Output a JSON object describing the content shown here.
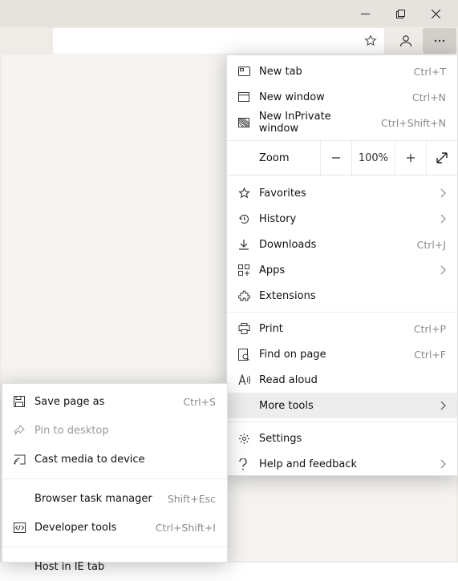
{
  "menu": {
    "new_tab": {
      "label": "New tab",
      "shortcut": "Ctrl+T"
    },
    "new_window": {
      "label": "New window",
      "shortcut": "Ctrl+N"
    },
    "new_inprivate": {
      "label": "New InPrivate window",
      "shortcut": "Ctrl+Shift+N"
    },
    "zoom": {
      "label": "Zoom",
      "percent": "100%"
    },
    "favorites": {
      "label": "Favorites"
    },
    "history": {
      "label": "History"
    },
    "downloads": {
      "label": "Downloads",
      "shortcut": "Ctrl+J"
    },
    "apps": {
      "label": "Apps"
    },
    "extensions": {
      "label": "Extensions"
    },
    "print": {
      "label": "Print",
      "shortcut": "Ctrl+P"
    },
    "find": {
      "label": "Find on page",
      "shortcut": "Ctrl+F"
    },
    "read_aloud": {
      "label": "Read aloud"
    },
    "more_tools": {
      "label": "More tools"
    },
    "settings": {
      "label": "Settings"
    },
    "help": {
      "label": "Help and feedback"
    }
  },
  "submenu": {
    "save_as": {
      "label": "Save page as",
      "shortcut": "Ctrl+S"
    },
    "pin": {
      "label": "Pin to desktop"
    },
    "cast": {
      "label": "Cast media to device"
    },
    "task_mgr": {
      "label": "Browser task manager",
      "shortcut": "Shift+Esc"
    },
    "dev_tools": {
      "label": "Developer tools",
      "shortcut": "Ctrl+Shift+I"
    },
    "ie_tab": {
      "label": "Host in IE tab"
    }
  }
}
